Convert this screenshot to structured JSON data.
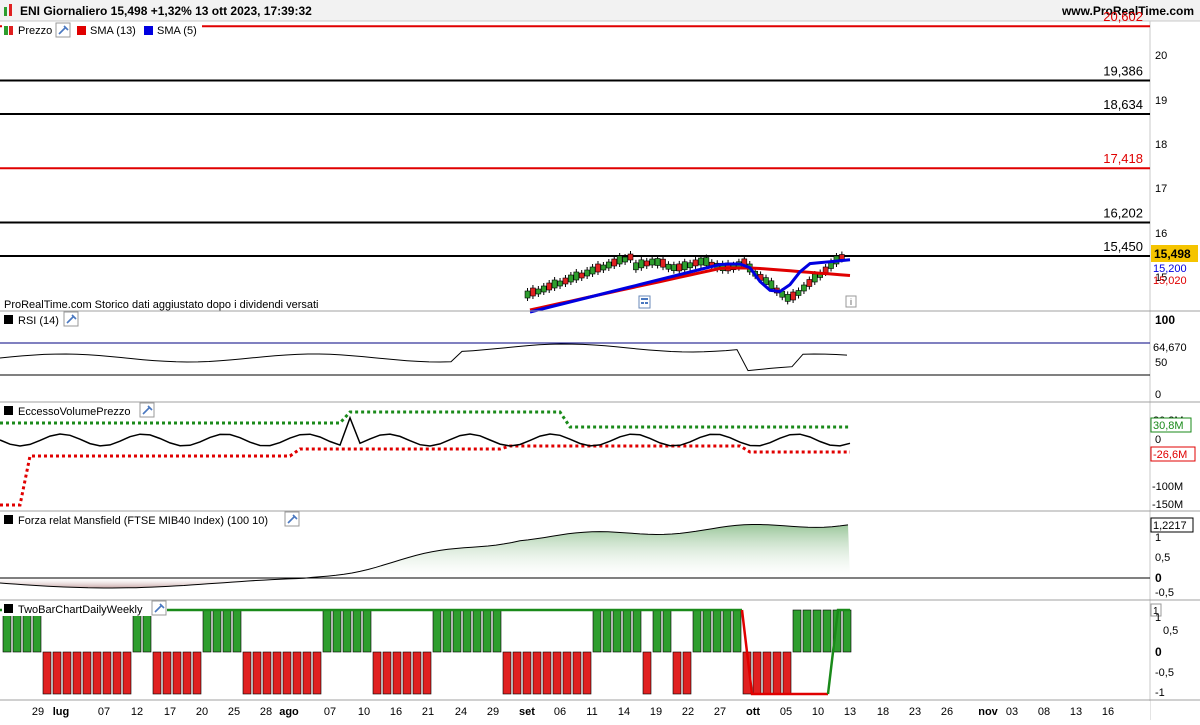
{
  "header": {
    "title": "ENI Giornaliero 15,498 +1,32% 13 ott 2023, 17:39:32",
    "site": "www.ProRealTime.com"
  },
  "panels": {
    "price": {
      "legend": [
        "Prezzo",
        "SMA (13)",
        "SMA (5)"
      ],
      "note": "ProRealTime.com  Storico dati aggiustato dopo i dividendi versati",
      "axis_ticks": [
        "20",
        "19",
        "18",
        "17",
        "16",
        "15"
      ],
      "levels": [
        {
          "label": "20,602",
          "value": 20.602,
          "color": "#e00000"
        },
        {
          "label": "19,386",
          "value": 19.386,
          "color": "#000000"
        },
        {
          "label": "18,634",
          "value": 18.634,
          "color": "#000000"
        },
        {
          "label": "17,418",
          "value": 17.418,
          "color": "#e00000"
        },
        {
          "label": "16,202",
          "value": 16.202,
          "color": "#000000"
        },
        {
          "label": "15,450",
          "value": 15.45,
          "color": "#000000"
        }
      ],
      "last_price": "15,498",
      "sma5_value": "15,200",
      "sma13_value": "15,020"
    },
    "rsi": {
      "title": "RSI (14)",
      "axis_ticks": [
        "100",
        "50",
        "0"
      ],
      "value": "64,670"
    },
    "eccesso": {
      "title": "EccessoVolumePrezzo",
      "axis_ticks": [
        "30,8M",
        "0",
        "-100M",
        "-150M"
      ],
      "upper": "30,8M",
      "lower": "-26,6M"
    },
    "mansfield": {
      "title": "Forza relat Mansfield (FTSE MIB40 Index) (100 10)",
      "axis_ticks": [
        "1",
        "0,5",
        "0",
        "-0,5"
      ],
      "value": "1,2217"
    },
    "twobar": {
      "title": "TwoBarChartDailyWeekly",
      "axis_ticks": [
        "1",
        "0,5",
        "0",
        "-0,5",
        "-1"
      ],
      "value": "1"
    }
  },
  "x_axis": {
    "labels": [
      {
        "t": "29",
        "bold": false
      },
      {
        "t": "lug",
        "bold": true
      },
      {
        "t": "07",
        "bold": false
      },
      {
        "t": "12",
        "bold": false
      },
      {
        "t": "17",
        "bold": false
      },
      {
        "t": "20",
        "bold": false
      },
      {
        "t": "25",
        "bold": false
      },
      {
        "t": "28",
        "bold": false
      },
      {
        "t": "ago",
        "bold": true
      },
      {
        "t": "07",
        "bold": false
      },
      {
        "t": "10",
        "bold": false
      },
      {
        "t": "16",
        "bold": false
      },
      {
        "t": "21",
        "bold": false
      },
      {
        "t": "24",
        "bold": false
      },
      {
        "t": "29",
        "bold": false
      },
      {
        "t": "set",
        "bold": true
      },
      {
        "t": "06",
        "bold": false
      },
      {
        "t": "11",
        "bold": false
      },
      {
        "t": "14",
        "bold": false
      },
      {
        "t": "19",
        "bold": false
      },
      {
        "t": "22",
        "bold": false
      },
      {
        "t": "27",
        "bold": false
      },
      {
        "t": "ott",
        "bold": true
      },
      {
        "t": "05",
        "bold": false
      },
      {
        "t": "10",
        "bold": false
      },
      {
        "t": "13",
        "bold": false
      },
      {
        "t": "18",
        "bold": false
      },
      {
        "t": "23",
        "bold": false
      },
      {
        "t": "26",
        "bold": false
      },
      {
        "t": "nov",
        "bold": true
      },
      {
        "t": "03",
        "bold": false
      },
      {
        "t": "08",
        "bold": false
      },
      {
        "t": "13",
        "bold": false
      },
      {
        "t": "16",
        "bold": false
      }
    ]
  },
  "colors": {
    "up": "#2e9e2e",
    "down": "#e02020",
    "sma13": "#e00000",
    "sma5": "#0000e0",
    "last": "#f5c400"
  }
}
